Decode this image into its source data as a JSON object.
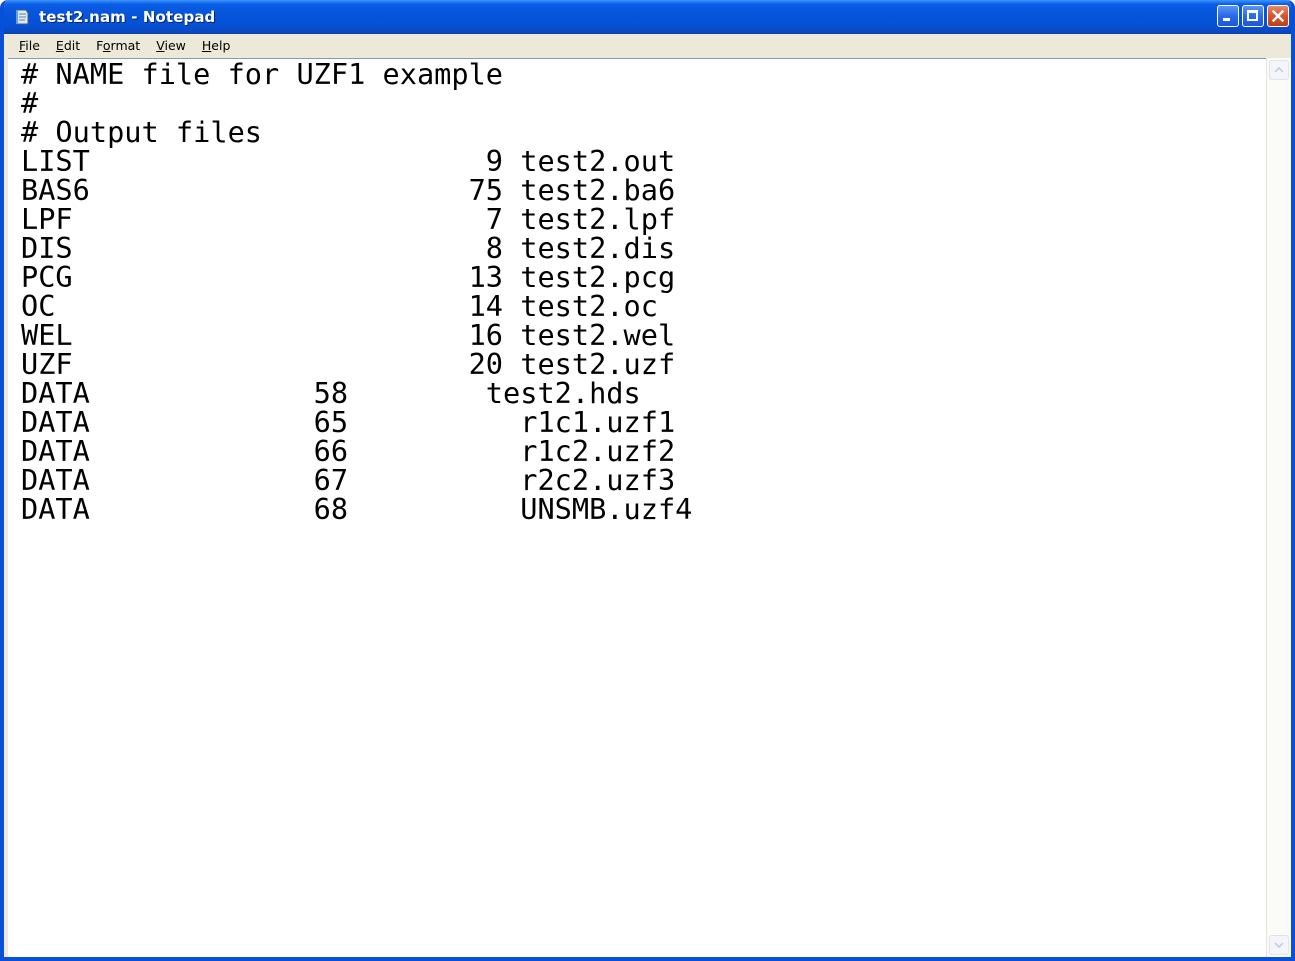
{
  "window": {
    "title": "test2.nam - Notepad",
    "icon": "notepad-icon",
    "controls": [
      "minimize-icon",
      "maximize-icon",
      "close-icon"
    ]
  },
  "menu": {
    "file": {
      "accel": "F",
      "rest": "ile"
    },
    "edit": {
      "accel": "E",
      "rest": "dit"
    },
    "format": {
      "pre": "F",
      "accel": "o",
      "rest": "rmat"
    },
    "view": {
      "accel": "V",
      "rest": "iew"
    },
    "help": {
      "accel": "H",
      "rest": "elp"
    }
  },
  "document": {
    "lines": [
      "# NAME file for UZF1 example",
      "#",
      "# Output files",
      "LIST                       9 test2.out",
      "BAS6                      75 test2.ba6",
      "LPF                        7 test2.lpf",
      "DIS                        8 test2.dis",
      "PCG                       13 test2.pcg",
      "OC                        14 test2.oc",
      "WEL                       16 test2.wel",
      "UZF                       20 test2.uzf",
      "DATA             58        test2.hds",
      "DATA             65          r1c1.uzf1",
      "DATA             66          r1c2.uzf2",
      "DATA             67          r2c2.uzf3",
      "DATA             68          UNSMB.uzf4"
    ]
  },
  "scrollbar": {
    "up_icon": "scroll-up-arrow-icon",
    "down_icon": "scroll-down-arrow-icon"
  }
}
